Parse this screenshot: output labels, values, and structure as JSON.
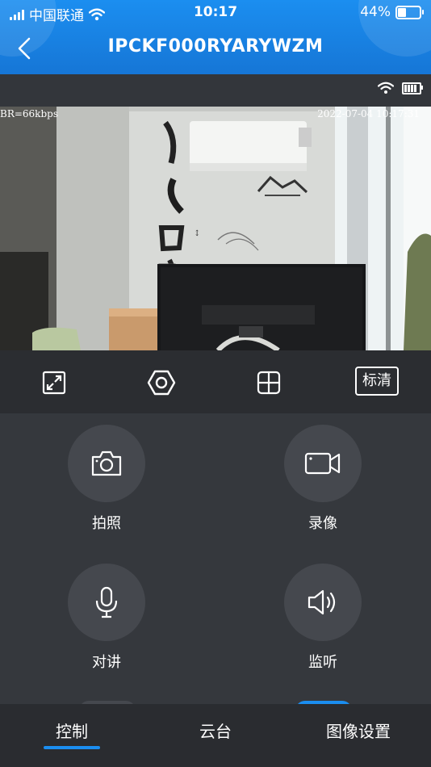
{
  "status_bar": {
    "carrier": "中国联通",
    "time": "10:17",
    "battery": "44%",
    "battery_level": 0.44
  },
  "header": {
    "title": "IPCKF000RYARYWZM"
  },
  "video": {
    "bitrate": "BR=66kbps",
    "timestamp": "2022-07-04 10:17:31"
  },
  "toolbar": {
    "quality_label": "标清"
  },
  "actions": {
    "photo": "拍照",
    "record": "录像",
    "talk": "对讲",
    "listen": "监听"
  },
  "tabs": [
    "控制",
    "云台",
    "图像设置"
  ],
  "colors": {
    "accent": "#1b8ef0",
    "background": "#34373c"
  }
}
